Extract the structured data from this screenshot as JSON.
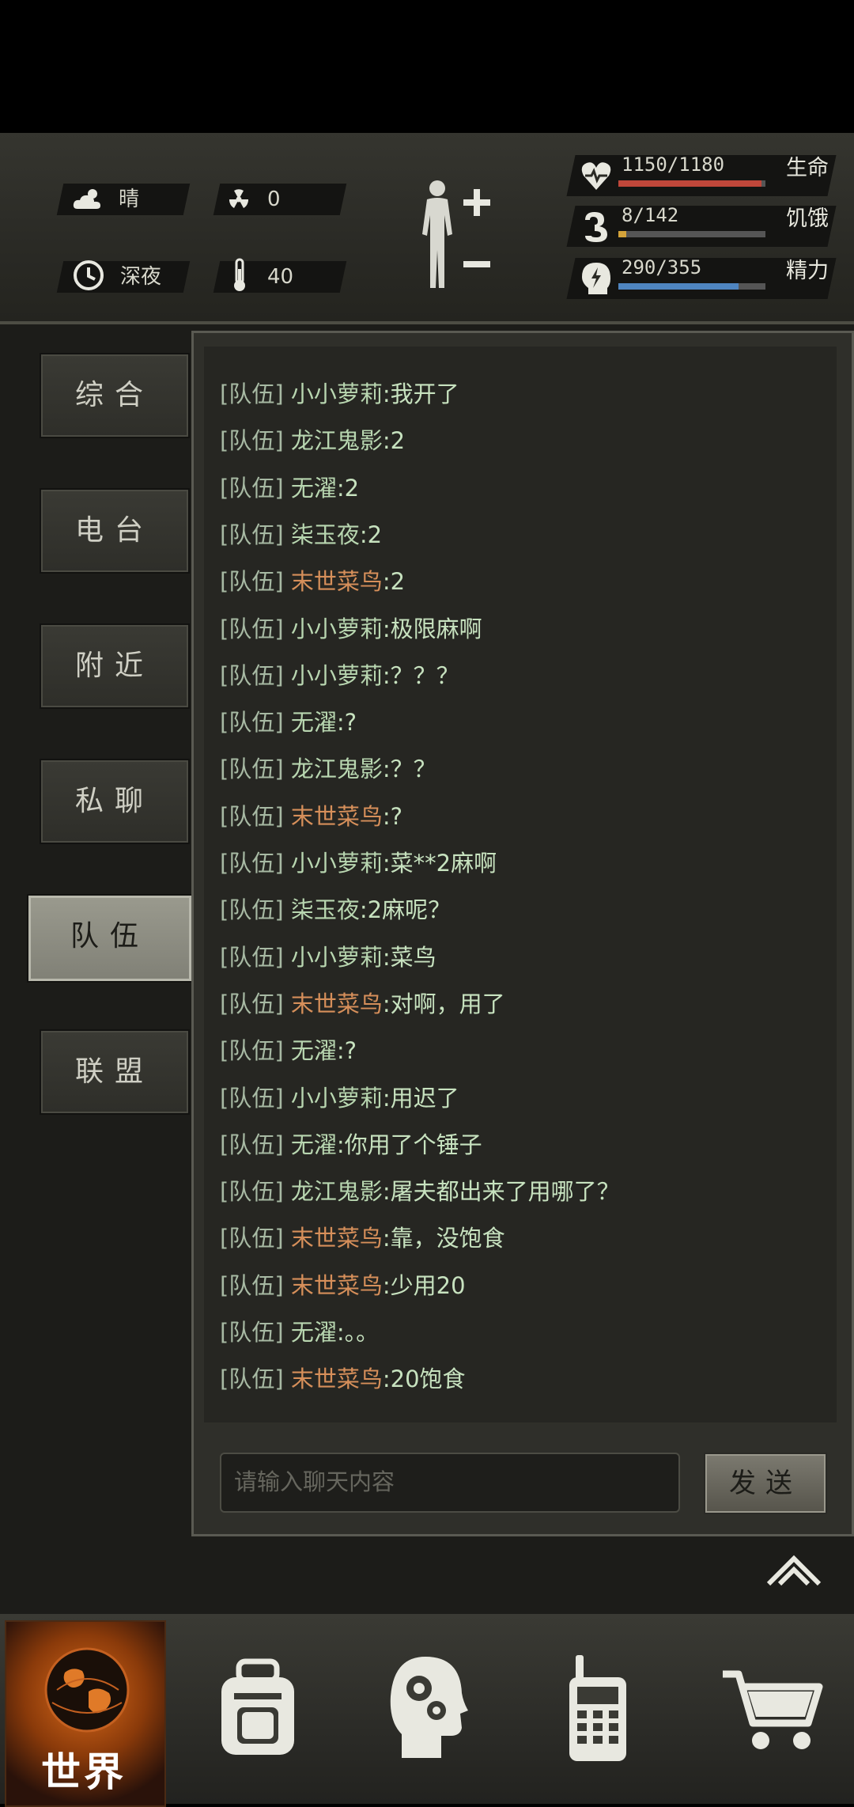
{
  "header": {
    "weather": {
      "icon": "cloud-sun-icon",
      "label": "晴"
    },
    "radiation": {
      "icon": "radiation-icon",
      "value": "0"
    },
    "time": {
      "icon": "clock-icon",
      "label": "深夜"
    },
    "temperature": {
      "icon": "thermometer-icon",
      "value": "40"
    },
    "body_icon": "body-status-icon",
    "vitals": [
      {
        "icon": "heart-icon",
        "value": "1150/1180",
        "label": "生命",
        "fraction": 0.975,
        "color": "#c0473a"
      },
      {
        "icon": "stomach-icon",
        "value": "8/142",
        "label": "饥饿",
        "fraction": 0.056,
        "color": "#d4a33a"
      },
      {
        "icon": "energy-head-icon",
        "value": "290/355",
        "label": "精力",
        "fraction": 0.817,
        "color": "#4f85c0"
      }
    ]
  },
  "tabs": [
    {
      "label": "综合",
      "active": false
    },
    {
      "label": "电台",
      "active": false
    },
    {
      "label": "附近",
      "active": false
    },
    {
      "label": "私聊",
      "active": false
    },
    {
      "label": "队伍",
      "active": true
    },
    {
      "label": "联盟",
      "active": false
    }
  ],
  "chat": {
    "messages": [
      {
        "tag": "[队伍]",
        "name": "小小萝莉",
        "text": ":我开了",
        "name_color": "green"
      },
      {
        "tag": "[队伍]",
        "name": "龙江鬼影",
        "text": ":2",
        "name_color": "green"
      },
      {
        "tag": "[队伍]",
        "name": "无濯",
        "text": ":2",
        "name_color": "green"
      },
      {
        "tag": "[队伍]",
        "name": "柒玉夜",
        "text": ":2",
        "name_color": "green"
      },
      {
        "tag": "[队伍]",
        "name": "末世菜鸟",
        "text": ":2",
        "name_color": "orange"
      },
      {
        "tag": "[队伍]",
        "name": "小小萝莉",
        "text": ":极限麻啊",
        "name_color": "green"
      },
      {
        "tag": "[队伍]",
        "name": "小小萝莉",
        "text": ":？？？",
        "name_color": "green"
      },
      {
        "tag": "[队伍]",
        "name": "无濯",
        "text": ":?",
        "name_color": "green"
      },
      {
        "tag": "[队伍]",
        "name": "龙江鬼影",
        "text": ":？？",
        "name_color": "green"
      },
      {
        "tag": "[队伍]",
        "name": "末世菜鸟",
        "text": ":?",
        "name_color": "orange"
      },
      {
        "tag": "[队伍]",
        "name": "小小萝莉",
        "text": ":菜**2麻啊",
        "name_color": "green"
      },
      {
        "tag": "[队伍]",
        "name": "柒玉夜",
        "text": ":2麻呢？",
        "name_color": "green"
      },
      {
        "tag": "[队伍]",
        "name": "小小萝莉",
        "text": ":菜鸟",
        "name_color": "green"
      },
      {
        "tag": "[队伍]",
        "name": "末世菜鸟",
        "text": ":对啊，用了",
        "name_color": "orange"
      },
      {
        "tag": "[队伍]",
        "name": "无濯",
        "text": ":?",
        "name_color": "green"
      },
      {
        "tag": "[队伍]",
        "name": "小小萝莉",
        "text": ":用迟了",
        "name_color": "green"
      },
      {
        "tag": "[队伍]",
        "name": "无濯",
        "text": ":你用了个锤子",
        "name_color": "green"
      },
      {
        "tag": "[队伍]",
        "name": "龙江鬼影",
        "text": ":屠夫都出来了用哪了？",
        "name_color": "green"
      },
      {
        "tag": "[队伍]",
        "name": "末世菜鸟",
        "text": ":靠，没饱食",
        "name_color": "orange"
      },
      {
        "tag": "[队伍]",
        "name": "末世菜鸟",
        "text": ":少用20",
        "name_color": "orange"
      },
      {
        "tag": "[队伍]",
        "name": "无濯",
        "text": ":。。",
        "name_color": "green"
      },
      {
        "tag": "[队伍]",
        "name": "末世菜鸟",
        "text": ":20饱食",
        "name_color": "orange"
      }
    ],
    "input_placeholder": "请输入聊天内容",
    "send_label": "发送",
    "collapse_icon": "chevron-up-double-icon"
  },
  "bottom_nav": [
    {
      "icon": "globe-icon",
      "label": "世界",
      "active": true
    },
    {
      "icon": "backpack-icon",
      "label": "",
      "active": false
    },
    {
      "icon": "brain-skills-icon",
      "label": "",
      "active": false
    },
    {
      "icon": "radio-walkie-icon",
      "label": "",
      "active": false
    },
    {
      "icon": "shopping-cart-icon",
      "label": "",
      "active": false
    }
  ]
}
